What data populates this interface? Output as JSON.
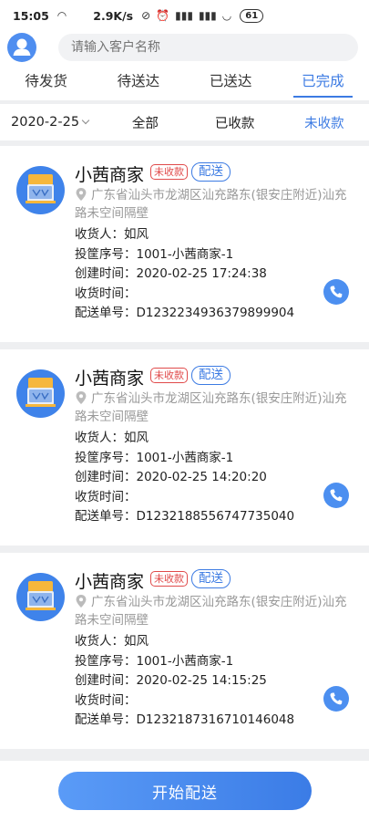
{
  "status_bar": {
    "time": "15:05",
    "speed": "2.9K/s",
    "battery": "61"
  },
  "header": {
    "search_placeholder": "请输入客户名称"
  },
  "tabs": [
    {
      "label": "待发货",
      "active": false
    },
    {
      "label": "待送达",
      "active": false
    },
    {
      "label": "已送达",
      "active": false
    },
    {
      "label": "已完成",
      "active": true
    }
  ],
  "filters": {
    "date": "2020-2-25",
    "all": "全部",
    "paid": "已收款",
    "unpaid": "未收款"
  },
  "orders": [
    {
      "store_name": "小茜商家",
      "payment_badge": "未收款",
      "delivery_badge": "配送",
      "address": "广东省汕头市龙湖区汕充路东(银安庄附近)汕充路未空间隔壁",
      "receiver": "收货人：如风",
      "basket_no": "投筐序号：1001-小茜商家-1",
      "created_time": "创建时间：2020-02-25 17:24:38",
      "received_time": "收货时间：",
      "delivery_no": "配送单号：D1232234936379899904"
    },
    {
      "store_name": "小茜商家",
      "payment_badge": "未收款",
      "delivery_badge": "配送",
      "address": "广东省汕头市龙湖区汕充路东(银安庄附近)汕充路未空间隔壁",
      "receiver": "收货人：如风",
      "basket_no": "投筐序号：1001-小茜商家-1",
      "created_time": "创建时间：2020-02-25 14:20:20",
      "received_time": "收货时间：",
      "delivery_no": "配送单号：D1232188556747735040"
    },
    {
      "store_name": "小茜商家",
      "payment_badge": "未收款",
      "delivery_badge": "配送",
      "address": "广东省汕头市龙湖区汕充路东(银安庄附近)汕充路未空间隔壁",
      "receiver": "收货人：如风",
      "basket_no": "投筐序号：1001-小茜商家-1",
      "created_time": "创建时间：2020-02-25 14:15:25",
      "received_time": "收货时间：",
      "delivery_no": "配送单号：D1232187316710146048"
    }
  ],
  "footer": {
    "start_button": "开始配送"
  },
  "colors": {
    "accent": "#3c7be3",
    "unpaid": "#e04a4a"
  }
}
